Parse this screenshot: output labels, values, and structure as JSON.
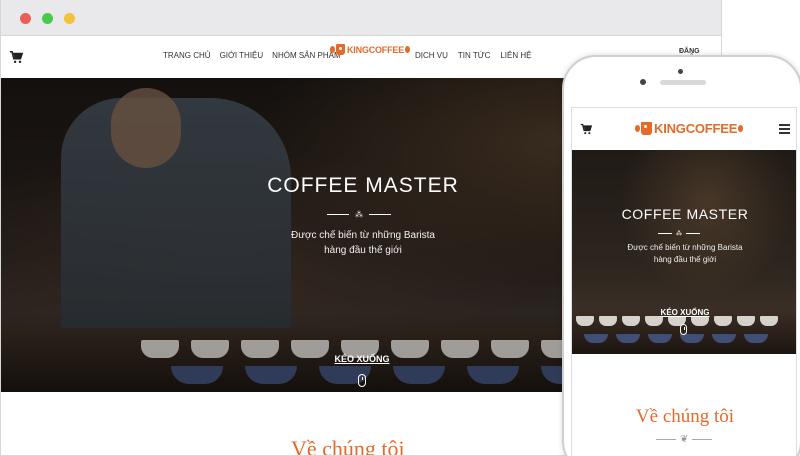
{
  "desktop": {
    "nav": {
      "left_items": [
        "TRANG CHỦ",
        "GIỚI THIỆU",
        "NHÓM SẢN PHẨM"
      ],
      "logo_text": "KINGCOFFEE",
      "right_items": [
        "DỊCH VỤ",
        "TIN TỨC",
        "LIÊN HỆ"
      ],
      "login": "ĐĂNG NHẬP"
    },
    "hero": {
      "title": "COFFEE MASTER",
      "subtitle_line1": "Được chế biến từ những Barista",
      "subtitle_line2": "hàng đầu thế giới",
      "scroll_button": "KÉO XUỐNG"
    },
    "about_title": "Về chúng tôi"
  },
  "mobile": {
    "logo_text": "KINGCOFFEE",
    "hero": {
      "title": "COFFEE MASTER",
      "subtitle_line1": "Được chế biến từ những Barista",
      "subtitle_line2": "hàng đầu thế giới",
      "scroll_button": "KÉO XUỐNG"
    },
    "about_title": "Về chúng tôi"
  },
  "colors": {
    "accent": "#e36a2b",
    "titlebar": "#e9e9ec",
    "close_dot": "#ec5f57",
    "min_dot": "#47c94a",
    "max_dot": "#f3c23a"
  },
  "icons": [
    "cart-icon",
    "hamburger-icon",
    "coffee-bean-icon",
    "mouse-scroll-icon"
  ]
}
